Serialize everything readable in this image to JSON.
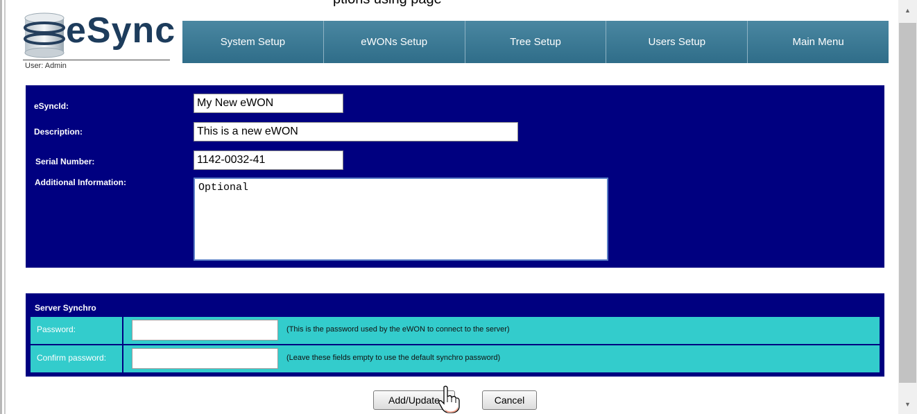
{
  "page": {
    "top_text": "ptions using page"
  },
  "header": {
    "logo_text": "eSync",
    "user_label": "User: Admin"
  },
  "nav": [
    {
      "label": "System Setup"
    },
    {
      "label": "eWONs Setup"
    },
    {
      "label": "Tree Setup"
    },
    {
      "label": "Users Setup"
    },
    {
      "label": "Main Menu"
    }
  ],
  "form": {
    "esyncid_label": "eSyncId:",
    "esyncid_value": "My New eWON",
    "description_label": "Description:",
    "description_value": "This is a new eWON",
    "serial_label": "Serial Number:",
    "serial_value": "1142-0032-41",
    "additional_label": "Additional Information:",
    "additional_value": "Optional"
  },
  "server_synchro": {
    "title": "Server Synchro",
    "password_label": "Password:",
    "password_note": "(This is the password used by the eWON to connect to the server)",
    "confirm_label": "Confirm password:",
    "confirm_note": "(Leave these fields empty to use the default synchro password)"
  },
  "buttons": {
    "add_update": "Add/Update",
    "cancel": "Cancel"
  },
  "colors": {
    "panel": "#000080",
    "row": "#33cccc",
    "nav": "#3a7894"
  }
}
